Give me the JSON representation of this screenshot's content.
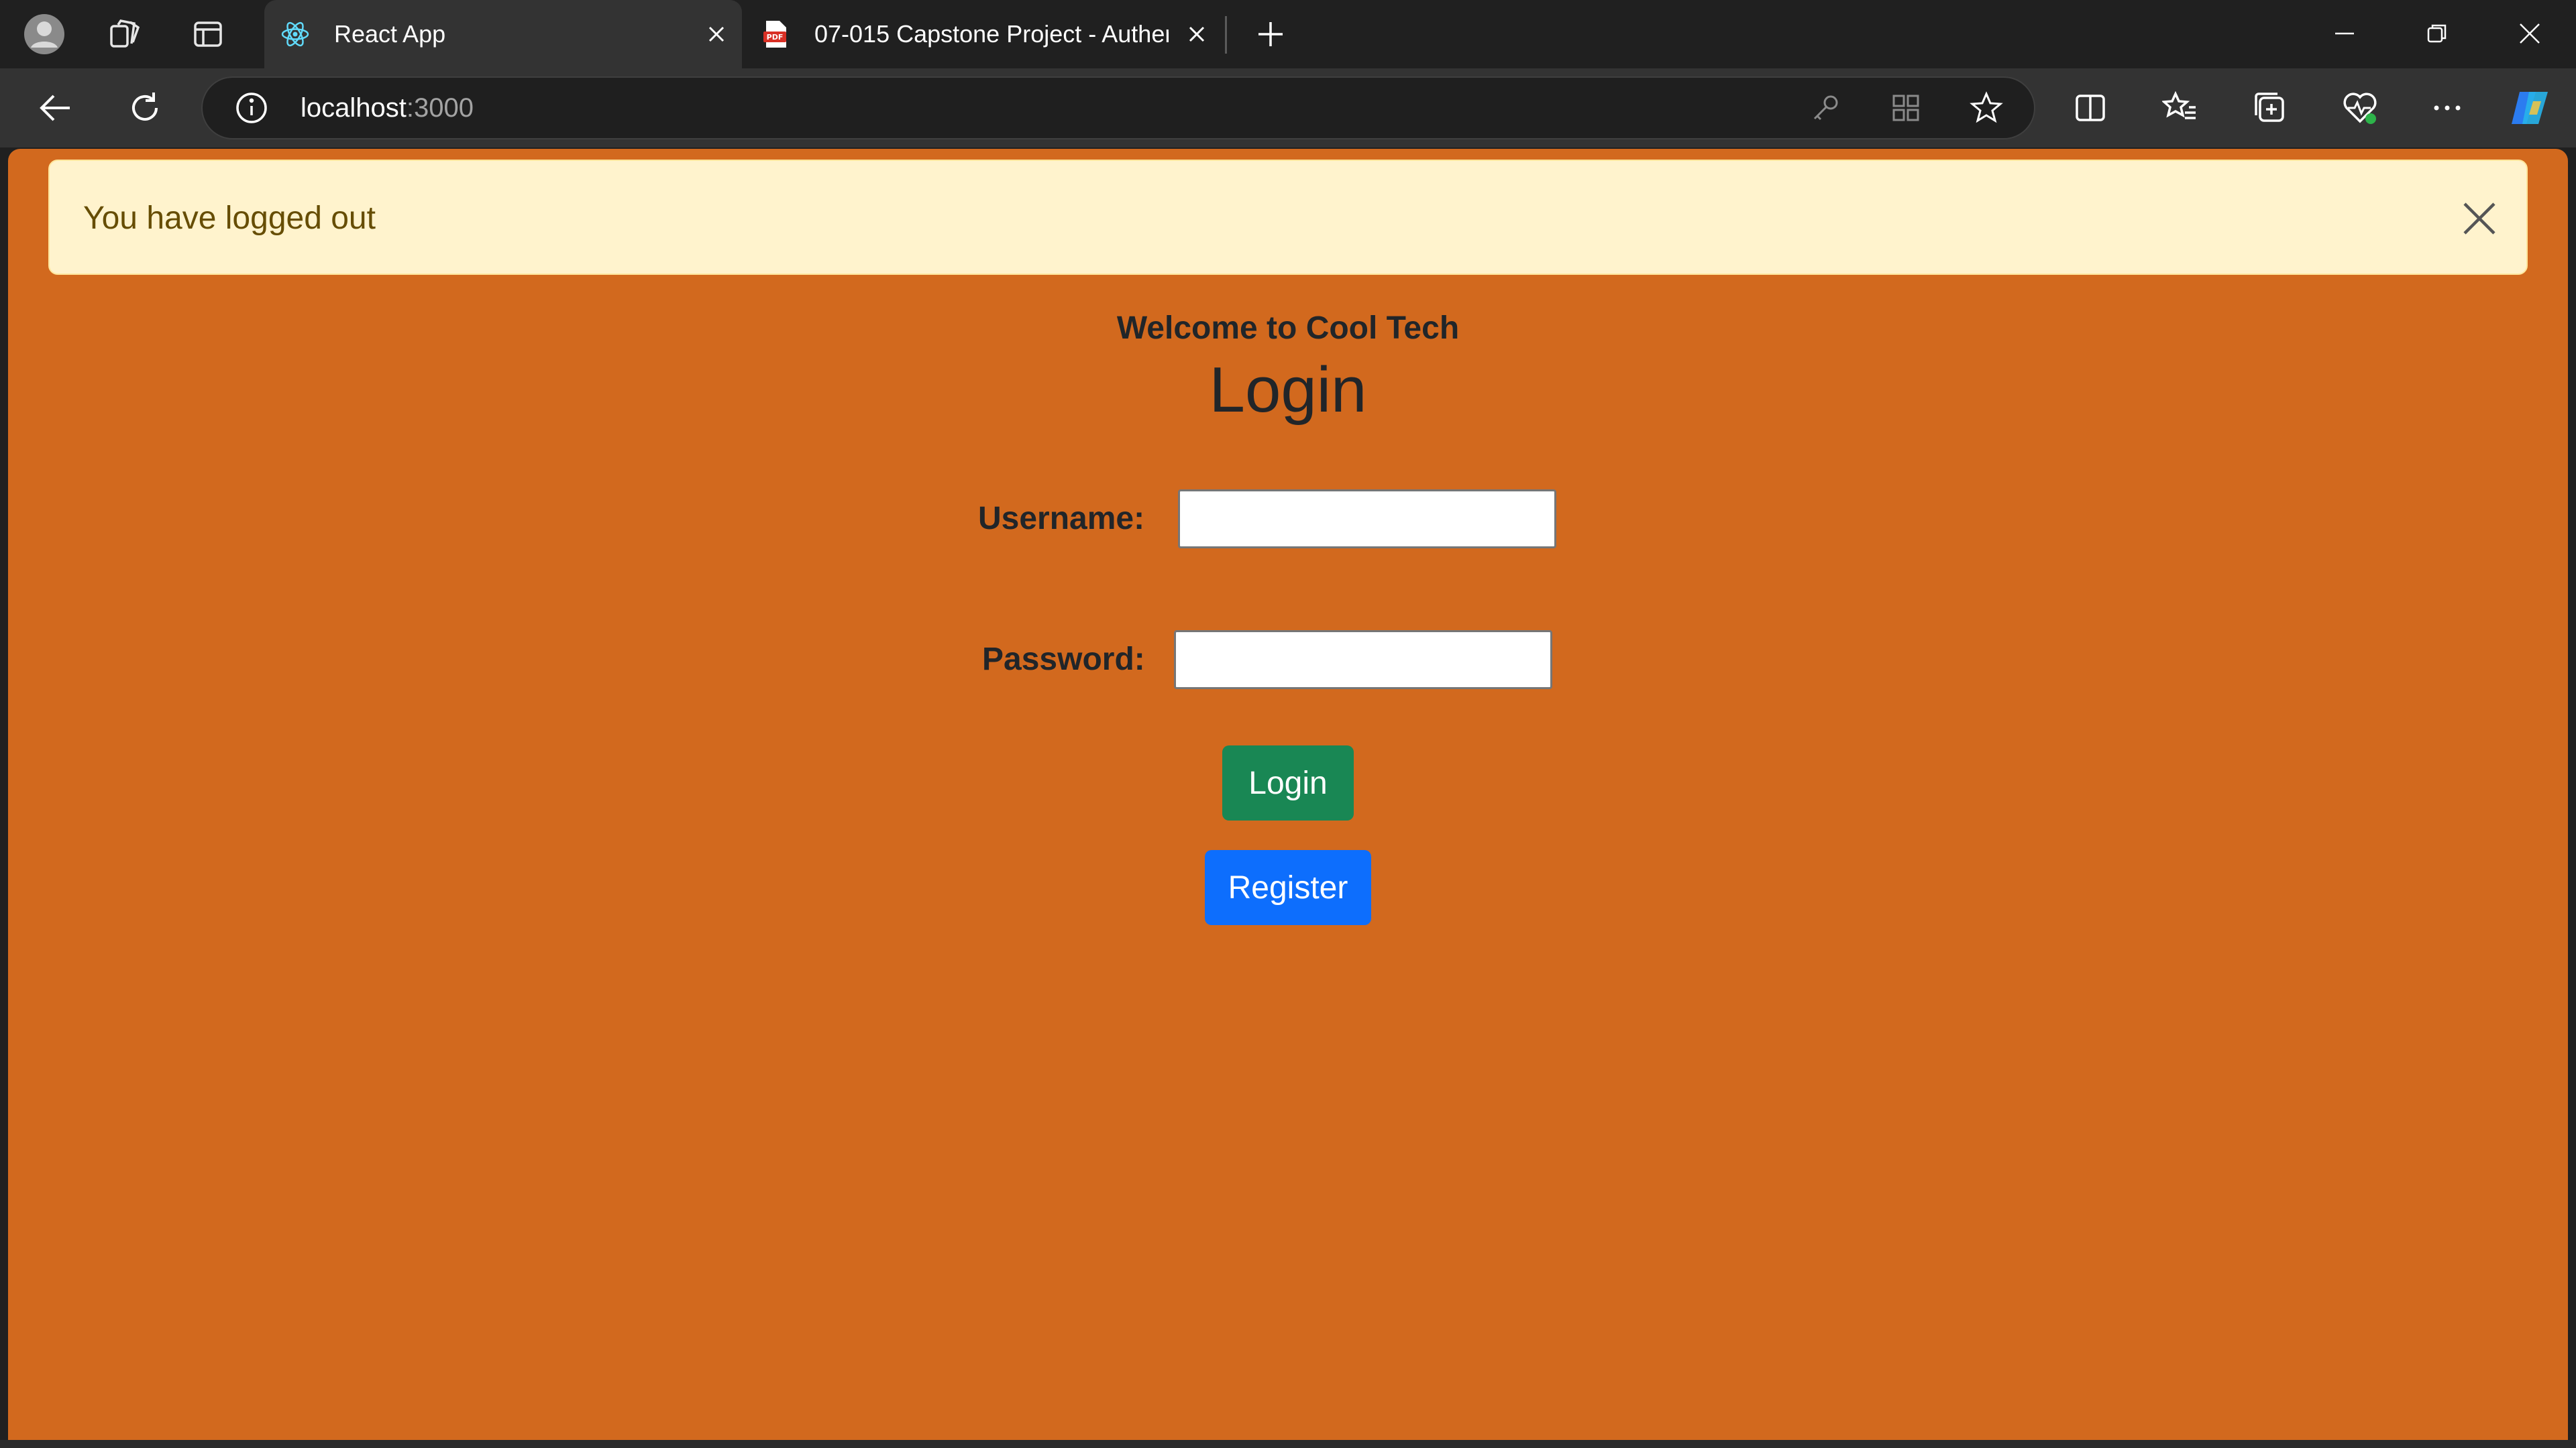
{
  "browser": {
    "tabs": [
      {
        "title": "React App",
        "favicon": "react-icon",
        "active": true
      },
      {
        "title": "07-015 Capstone Project - Auther",
        "favicon": "pdf-icon",
        "active": false
      }
    ],
    "address": {
      "host": "localhost",
      "port": ":3000"
    },
    "colors": {
      "tabbar": "#202020",
      "toolbar": "#333333"
    }
  },
  "page": {
    "background": "#d2691e",
    "alert": {
      "message": "You have logged out",
      "type": "warning"
    },
    "welcome": "Welcome to Cool Tech",
    "title": "Login",
    "form": {
      "username_label": "Username:",
      "username_value": "",
      "password_label": "Password:",
      "password_value": ""
    },
    "buttons": {
      "login": "Login",
      "register": "Register"
    }
  }
}
